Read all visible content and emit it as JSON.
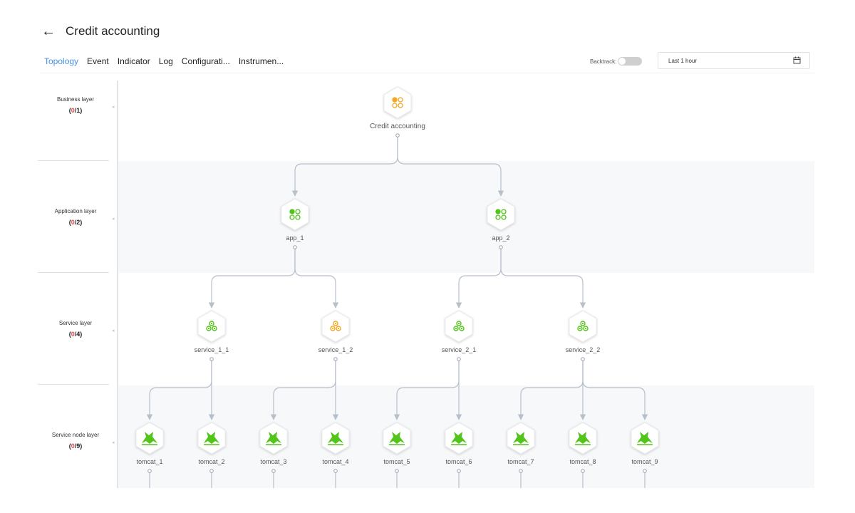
{
  "header": {
    "back_icon": "←",
    "title": "Credit accounting"
  },
  "tabs": [
    {
      "label": "Topology",
      "active": true
    },
    {
      "label": "Event"
    },
    {
      "label": "Indicator"
    },
    {
      "label": "Log"
    },
    {
      "label": "Configurati..."
    },
    {
      "label": "Instrumen..."
    }
  ],
  "backtrack": {
    "label": "Backtrack:",
    "enabled": false
  },
  "time_range": {
    "value": "Last 1 hour",
    "icon": "calendar-icon"
  },
  "layers": [
    {
      "name": "Business layer",
      "abnormal": "0",
      "total": "/1"
    },
    {
      "name": "Application layer",
      "abnormal": "0",
      "total": "/2"
    },
    {
      "name": "Service layer",
      "abnormal": "0",
      "total": "/4"
    },
    {
      "name": "Service node layer",
      "abnormal": "0",
      "total": "/9"
    }
  ],
  "colors": {
    "accent": "#4a90e2",
    "healthy": "#52c41a",
    "warning": "#f5a623",
    "error": "#e84d4d",
    "edge": "#b7bfca"
  },
  "nodes": {
    "business": [
      {
        "label": "Credit accounting",
        "icon": "business-icon",
        "status": "warning"
      }
    ],
    "application": [
      {
        "label": "app_1",
        "icon": "application-icon",
        "status": "healthy"
      },
      {
        "label": "app_2",
        "icon": "application-icon",
        "status": "healthy"
      }
    ],
    "service": [
      {
        "label": "service_1_1",
        "icon": "service-icon",
        "status": "healthy"
      },
      {
        "label": "service_1_2",
        "icon": "service-icon",
        "status": "warning"
      },
      {
        "label": "service_2_1",
        "icon": "service-icon",
        "status": "healthy"
      },
      {
        "label": "service_2_2",
        "icon": "service-icon",
        "status": "healthy"
      }
    ],
    "node": [
      {
        "label": "tomcat_1",
        "icon": "tomcat-icon",
        "status": "healthy"
      },
      {
        "label": "tomcat_2",
        "icon": "tomcat-icon",
        "status": "healthy"
      },
      {
        "label": "tomcat_3",
        "icon": "tomcat-icon",
        "status": "healthy"
      },
      {
        "label": "tomcat_4",
        "icon": "tomcat-icon",
        "status": "healthy"
      },
      {
        "label": "tomcat_5",
        "icon": "tomcat-icon",
        "status": "healthy"
      },
      {
        "label": "tomcat_6",
        "icon": "tomcat-icon",
        "status": "healthy"
      },
      {
        "label": "tomcat_7",
        "icon": "tomcat-icon",
        "status": "healthy"
      },
      {
        "label": "tomcat_8",
        "icon": "tomcat-icon",
        "status": "healthy"
      },
      {
        "label": "tomcat_9",
        "icon": "tomcat-icon",
        "status": "healthy"
      }
    ]
  },
  "edges": [
    [
      "Credit accounting",
      "app_1"
    ],
    [
      "Credit accounting",
      "app_2"
    ],
    [
      "app_1",
      "service_1_1"
    ],
    [
      "app_1",
      "service_1_2"
    ],
    [
      "app_2",
      "service_2_1"
    ],
    [
      "app_2",
      "service_2_2"
    ],
    [
      "service_1_1",
      "tomcat_1"
    ],
    [
      "service_1_1",
      "tomcat_2"
    ],
    [
      "service_1_2",
      "tomcat_3"
    ],
    [
      "service_1_2",
      "tomcat_4"
    ],
    [
      "service_2_1",
      "tomcat_5"
    ],
    [
      "service_2_1",
      "tomcat_6"
    ],
    [
      "service_2_2",
      "tomcat_7"
    ],
    [
      "service_2_2",
      "tomcat_8"
    ],
    [
      "service_2_2",
      "tomcat_9"
    ]
  ]
}
